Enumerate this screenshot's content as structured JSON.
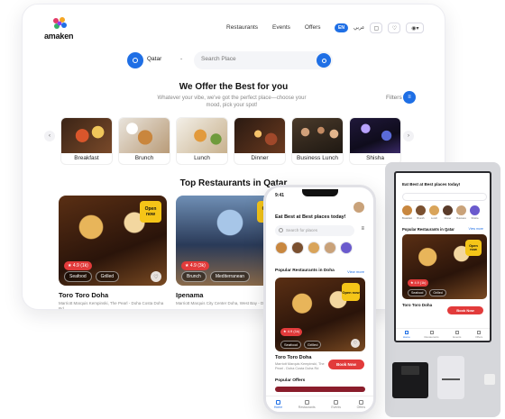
{
  "brand": {
    "name": "amaken"
  },
  "nav": {
    "links": [
      "Restaurants",
      "Events",
      "Offers"
    ],
    "lang_en": "EN",
    "lang_ar": "عربي"
  },
  "search": {
    "country": "Qatar",
    "placeholder": "Search Place"
  },
  "offers": {
    "title": "We Offer the Best for you",
    "subtitle": "Whatever your vibe, we've got the perfect place—choose your mood, pick your spot!",
    "filters_label": "Filters"
  },
  "categories": [
    "Breakfast",
    "Brunch",
    "Lunch",
    "Dinner",
    "Business Lunch",
    "Shisha"
  ],
  "top_restaurants": {
    "title": "Top Restaurants in Qatar",
    "cards": [
      {
        "open_label": "Open now",
        "rating": "4.9 (1k)",
        "tags": [
          "Seafood",
          "Grilled"
        ],
        "name": "Toro Toro Doha",
        "address": "Marriott Marquis Kempinski, The Pearl - Doha Costa Doha Rd"
      },
      {
        "open_label": "Open now",
        "rating": "4.9 (3k)",
        "tags": [
          "Brunch",
          "Mediterranean"
        ],
        "name": "Ipenama",
        "address": "Marriott Marquis City Center Doha, West Bay - Doha"
      }
    ]
  },
  "phone": {
    "status_time": "9:41",
    "greeting": "Eat Best at Best places today!",
    "search_placeholder": "Search for places",
    "popular_title": "Popular Restaurants in Doha",
    "view_all": "View more",
    "card": {
      "open_label": "Open now",
      "rating": "4.9 (1k)",
      "tags": [
        "Seafood",
        "Grilled"
      ]
    },
    "restaurant_name": "Toro Toro Doha",
    "restaurant_address": "Marriott Marquis Kempinski, The Pearl - Doha Costa Doha Rd",
    "book_label": "Book Now",
    "offers_title": "Popular Offers",
    "tabs": [
      "Home",
      "Restaurants",
      "Events",
      "Offers"
    ]
  },
  "kiosk": {
    "greeting": "Eat Best at Best places today!",
    "category_labels": [
      "Breakfast",
      "Brunch",
      "Lunch",
      "Dinner",
      "Business",
      "Shisha"
    ],
    "popular_title": "Popular Restaurants in Qatar",
    "view_all": "View more",
    "card": {
      "open_label": "Open now",
      "rating": "4.9 (1k)",
      "tags": [
        "Seafood",
        "Grilled"
      ]
    },
    "restaurant_name": "Toro Toro Doha",
    "book_label": "Book Now",
    "tabs": [
      "Home",
      "Restaurants",
      "Events",
      "Offers"
    ]
  },
  "colors": {
    "accent": "#1f6fe5",
    "book_red": "#e23b3b",
    "open_badge": "#f5c518"
  }
}
